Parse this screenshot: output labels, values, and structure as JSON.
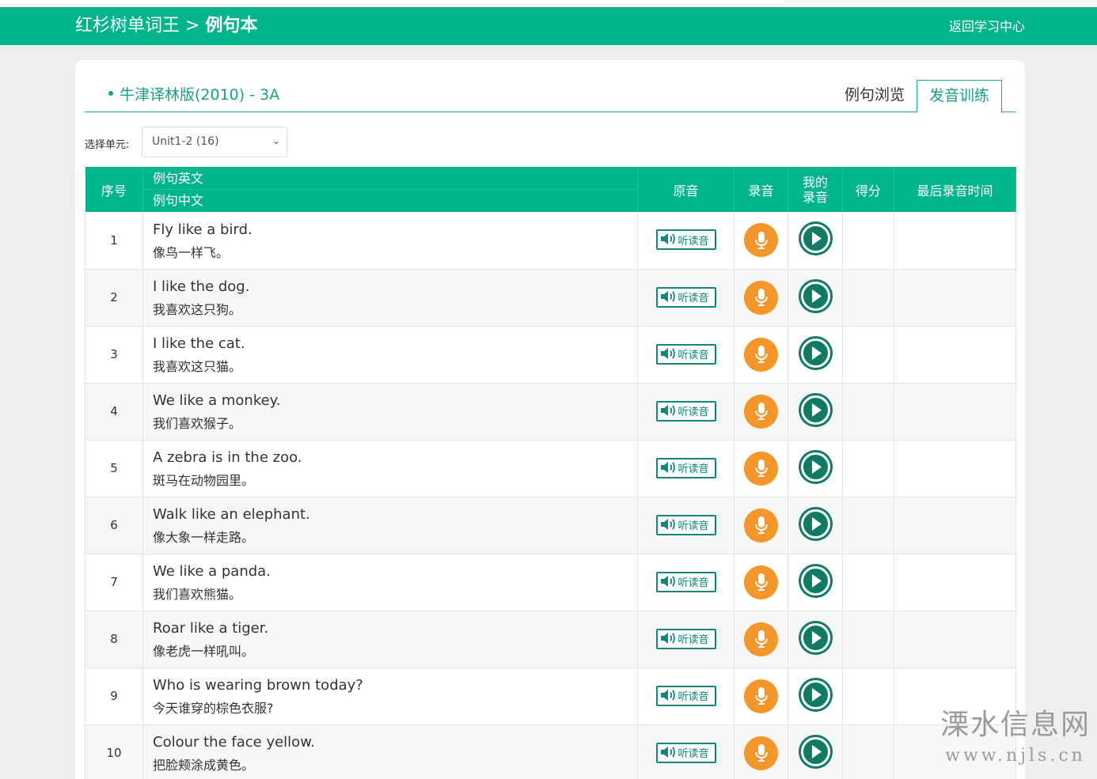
{
  "header": {
    "brand": "红杉树单词王",
    "separator": " > ",
    "page": "例句本",
    "back_link": "返回学习中心"
  },
  "book": {
    "title": "牛津译林版(2010)  -  3A"
  },
  "tabs": {
    "browse": "例句浏览",
    "practice": "发音训练"
  },
  "unit": {
    "label": "选择单元:",
    "selected": "Unit1-2 (16)"
  },
  "table": {
    "headers": {
      "index": "序号",
      "english": "例句英文",
      "chinese": "例句中文",
      "original": "原音",
      "record": "录音",
      "my_record_1": "我的",
      "my_record_2": "录音",
      "score": "得分",
      "last_time": "最后录音时间"
    },
    "listen_label": "听读音",
    "rows": [
      {
        "index": "1",
        "en": "Fly like a bird.",
        "zh": "像鸟一样飞。",
        "score": "",
        "time": ""
      },
      {
        "index": "2",
        "en": "I like the dog.",
        "zh": "我喜欢这只狗。",
        "score": "",
        "time": ""
      },
      {
        "index": "3",
        "en": "I like the cat.",
        "zh": "我喜欢这只猫。",
        "score": "",
        "time": ""
      },
      {
        "index": "4",
        "en": "We like a monkey.",
        "zh": "我们喜欢猴子。",
        "score": "",
        "time": ""
      },
      {
        "index": "5",
        "en": "A zebra is in the zoo.",
        "zh": "斑马在动物园里。",
        "score": "",
        "time": ""
      },
      {
        "index": "6",
        "en": "Walk like an elephant.",
        "zh": "像大象一样走路。",
        "score": "",
        "time": ""
      },
      {
        "index": "7",
        "en": "We like a panda.",
        "zh": "我们喜欢熊猫。",
        "score": "",
        "time": ""
      },
      {
        "index": "8",
        "en": "Roar like a tiger.",
        "zh": "像老虎一样吼叫。",
        "score": "",
        "time": ""
      },
      {
        "index": "9",
        "en": "Who is wearing brown today?",
        "zh": "今天谁穿的棕色衣服?",
        "score": "",
        "time": ""
      },
      {
        "index": "10",
        "en": "Colour the face yellow.",
        "zh": "把脸颊涂成黄色。",
        "score": "",
        "time": ""
      }
    ]
  },
  "watermark": {
    "name": "溧水信息网",
    "url": "www.njls.cn"
  },
  "colors": {
    "brand_green": "#00b48c",
    "accent_teal": "#16a085",
    "mic_orange": "#f5962b",
    "play_green": "#0f7a65"
  }
}
